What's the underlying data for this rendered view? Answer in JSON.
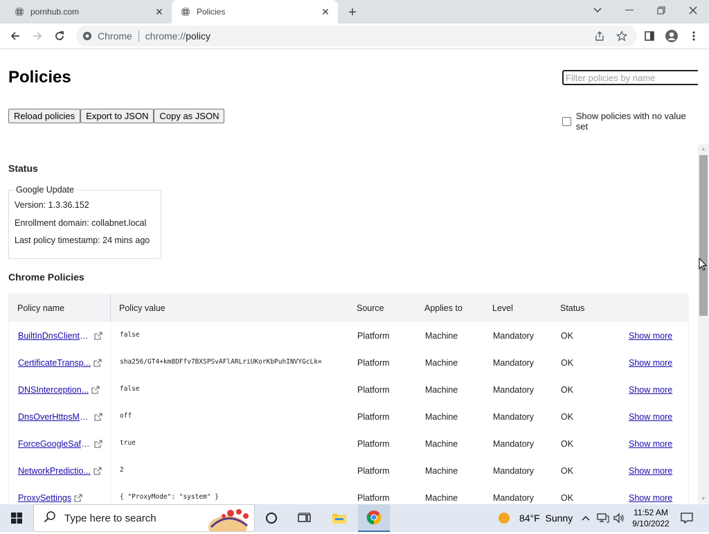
{
  "tabs": [
    {
      "title": "pornhub.com",
      "active": false
    },
    {
      "title": "Policies",
      "active": true
    }
  ],
  "toolbar": {
    "omnibox_label": "Chrome",
    "url_scheme": "chrome://",
    "url_path": "policy"
  },
  "page": {
    "title": "Policies",
    "filter_placeholder": "Filter policies by name",
    "buttons": {
      "reload": "Reload policies",
      "export": "Export to JSON",
      "copy": "Copy as JSON"
    },
    "show_no_value_label": "Show policies with no value set",
    "status_heading": "Status",
    "status_box": {
      "legend": "Google Update",
      "version": "Version: 1.3.36.152",
      "enrollment": "Enrollment domain: collabnet.local",
      "timestamp": "Last policy timestamp: 24 mins ago"
    },
    "chrome_policies_heading": "Chrome Policies",
    "table": {
      "headers": {
        "name": "Policy name",
        "value": "Policy value",
        "source": "Source",
        "applies": "Applies to",
        "level": "Level",
        "status": "Status"
      },
      "rows": [
        {
          "name": "BuiltInDnsClientE...",
          "value": "false",
          "source": "Platform",
          "applies": "Machine",
          "level": "Mandatory",
          "status": "OK",
          "more": "Show more"
        },
        {
          "name": "CertificateTransp...",
          "value": "sha256/GT4+km8DFfv7BXSPSvAFlARLriUKorKbPuhINVYGcLk=",
          "source": "Platform",
          "applies": "Machine",
          "level": "Mandatory",
          "status": "OK",
          "more": "Show more"
        },
        {
          "name": "DNSInterception...",
          "value": "false",
          "source": "Platform",
          "applies": "Machine",
          "level": "Mandatory",
          "status": "OK",
          "more": "Show more"
        },
        {
          "name": "DnsOverHttpsMo...",
          "value": "off",
          "source": "Platform",
          "applies": "Machine",
          "level": "Mandatory",
          "status": "OK",
          "more": "Show more"
        },
        {
          "name": "ForceGoogleSafe...",
          "value": "true",
          "source": "Platform",
          "applies": "Machine",
          "level": "Mandatory",
          "status": "OK",
          "more": "Show more"
        },
        {
          "name": "NetworkPredictio...",
          "value": "2",
          "source": "Platform",
          "applies": "Machine",
          "level": "Mandatory",
          "status": "OK",
          "more": "Show more"
        },
        {
          "name": "ProxySettings",
          "value": "{ \"ProxyMode\": \"system\" }",
          "source": "Platform",
          "applies": "Machine",
          "level": "Mandatory",
          "status": "OK",
          "more": "Show more"
        }
      ]
    }
  },
  "taskbar": {
    "search_placeholder": "Type here to search",
    "weather": "84°F  Sunny",
    "time": "11:52 AM",
    "date": "9/10/2022"
  },
  "colors": {
    "link": "#1a0dab",
    "tabstrip": "#dee1e6",
    "taskbar": "#e1e8f1"
  }
}
